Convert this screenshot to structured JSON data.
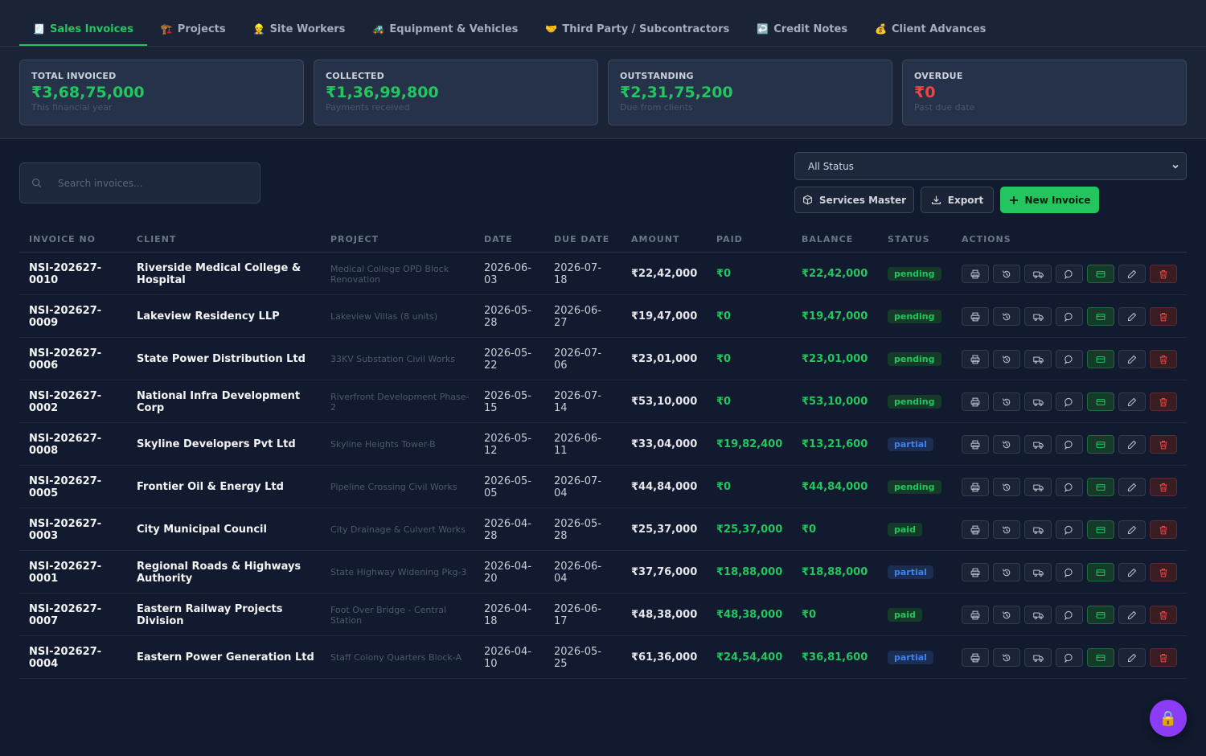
{
  "tabs": [
    {
      "icon": "🧾",
      "label": "Sales Invoices",
      "active": true
    },
    {
      "icon": "🏗️",
      "label": "Projects"
    },
    {
      "icon": "👷",
      "label": "Site Workers"
    },
    {
      "icon": "🚜",
      "label": "Equipment & Vehicles"
    },
    {
      "icon": "🤝",
      "label": "Third Party / Subcontractors"
    },
    {
      "icon": "↩️",
      "label": "Credit Notes"
    },
    {
      "icon": "💰",
      "label": "Client Advances"
    }
  ],
  "stats": [
    {
      "label": "TOTAL INVOICED",
      "value": "₹3,68,75,000",
      "sub": "This financial year",
      "color": "#22c55e"
    },
    {
      "label": "COLLECTED",
      "value": "₹1,36,99,800",
      "sub": "Payments received",
      "color": "#22c55e"
    },
    {
      "label": "OUTSTANDING",
      "value": "₹2,31,75,200",
      "sub": "Due from clients",
      "color": "#22c55e"
    },
    {
      "label": "OVERDUE",
      "value": "₹0",
      "sub": "Past due date",
      "color": "#ef4444"
    }
  ],
  "toolbar": {
    "search_placeholder": "Search invoices...",
    "status_filter": "All Status",
    "services_master_label": "Services Master",
    "export_label": "Export",
    "new_invoice_label": "New Invoice"
  },
  "table": {
    "columns": [
      "INVOICE NO",
      "CLIENT",
      "PROJECT",
      "DATE",
      "DUE DATE",
      "AMOUNT",
      "PAID",
      "BALANCE",
      "STATUS",
      "ACTIONS"
    ],
    "rows": [
      {
        "invoice_no": "NSI-202627-0010",
        "client": "Riverside Medical College & Hospital",
        "project": "Medical College OPD Block Renovation",
        "date": "2026-06-03",
        "due_date": "2026-07-18",
        "amount": "₹22,42,000",
        "paid": "₹0",
        "balance": "₹22,42,000",
        "status": "pending"
      },
      {
        "invoice_no": "NSI-202627-0009",
        "client": "Lakeview Residency LLP",
        "project": "Lakeview Villas (8 units)",
        "date": "2026-05-28",
        "due_date": "2026-06-27",
        "amount": "₹19,47,000",
        "paid": "₹0",
        "balance": "₹19,47,000",
        "status": "pending"
      },
      {
        "invoice_no": "NSI-202627-0006",
        "client": "State Power Distribution Ltd",
        "project": "33KV Substation Civil Works",
        "date": "2026-05-22",
        "due_date": "2026-07-06",
        "amount": "₹23,01,000",
        "paid": "₹0",
        "balance": "₹23,01,000",
        "status": "pending"
      },
      {
        "invoice_no": "NSI-202627-0002",
        "client": "National Infra Development Corp",
        "project": "Riverfront Development Phase-2",
        "date": "2026-05-15",
        "due_date": "2026-07-14",
        "amount": "₹53,10,000",
        "paid": "₹0",
        "balance": "₹53,10,000",
        "status": "pending"
      },
      {
        "invoice_no": "NSI-202627-0008",
        "client": "Skyline Developers Pvt Ltd",
        "project": "Skyline Heights Tower-B",
        "date": "2026-05-12",
        "due_date": "2026-06-11",
        "amount": "₹33,04,000",
        "paid": "₹19,82,400",
        "balance": "₹13,21,600",
        "status": "partial"
      },
      {
        "invoice_no": "NSI-202627-0005",
        "client": "Frontier Oil & Energy Ltd",
        "project": "Pipeline Crossing Civil Works",
        "date": "2026-05-05",
        "due_date": "2026-07-04",
        "amount": "₹44,84,000",
        "paid": "₹0",
        "balance": "₹44,84,000",
        "status": "pending"
      },
      {
        "invoice_no": "NSI-202627-0003",
        "client": "City Municipal Council",
        "project": "City Drainage & Culvert Works",
        "date": "2026-04-28",
        "due_date": "2026-05-28",
        "amount": "₹25,37,000",
        "paid": "₹25,37,000",
        "balance": "₹0",
        "status": "paid"
      },
      {
        "invoice_no": "NSI-202627-0001",
        "client": "Regional Roads & Highways Authority",
        "project": "State Highway Widening Pkg-3",
        "date": "2026-04-20",
        "due_date": "2026-06-04",
        "amount": "₹37,76,000",
        "paid": "₹18,88,000",
        "balance": "₹18,88,000",
        "status": "partial"
      },
      {
        "invoice_no": "NSI-202627-0007",
        "client": "Eastern Railway Projects Division",
        "project": "Foot Over Bridge - Central Station",
        "date": "2026-04-18",
        "due_date": "2026-06-17",
        "amount": "₹48,38,000",
        "paid": "₹48,38,000",
        "balance": "₹0",
        "status": "paid"
      },
      {
        "invoice_no": "NSI-202627-0004",
        "client": "Eastern Power Generation Ltd",
        "project": "Staff Colony Quarters Block-A",
        "date": "2026-04-10",
        "due_date": "2026-05-25",
        "amount": "₹61,36,000",
        "paid": "₹24,54,400",
        "balance": "₹36,81,600",
        "status": "partial"
      }
    ]
  },
  "actions": [
    {
      "name": "print-icon",
      "style": "default"
    },
    {
      "name": "history-icon",
      "style": "default"
    },
    {
      "name": "truck-icon",
      "style": "default"
    },
    {
      "name": "comment-icon",
      "style": "default"
    },
    {
      "name": "payment-card-icon",
      "style": "green"
    },
    {
      "name": "edit-pencil-icon",
      "style": "default"
    },
    {
      "name": "trash-icon",
      "style": "red"
    }
  ],
  "fab_icon": "🔒",
  "colors": {
    "accent": "#22c55e",
    "danger": "#ef4444",
    "partial": "#3b82f6",
    "fab": "#8b3cf7"
  }
}
